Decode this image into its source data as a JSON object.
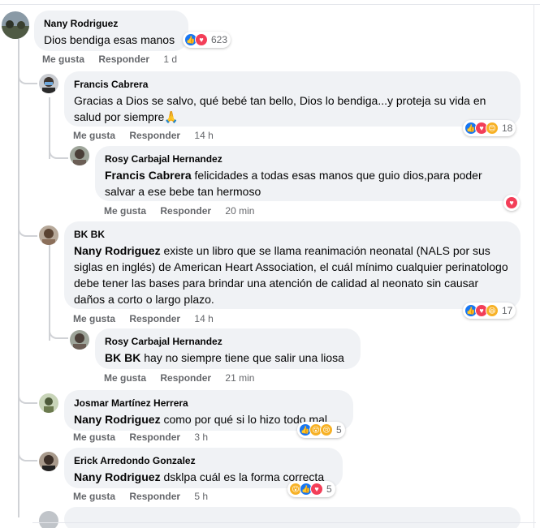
{
  "comments": [
    {
      "author": "Nany Rodriguez",
      "text": "Dios bendiga esas manos",
      "reactions": {
        "icons": [
          "like",
          "love"
        ],
        "count": "623"
      },
      "actions": {
        "like": "Me gusta",
        "reply": "Responder",
        "time": "1 d"
      }
    },
    {
      "author": "Francis Cabrera",
      "text": "Gracias a Dios se salvo, qué bebé tan bello, Dios lo bendiga...y proteja su vida en salud por siempre🙏",
      "reactions": {
        "icons": [
          "like",
          "love",
          "care"
        ],
        "count": "18"
      },
      "actions": {
        "like": "Me gusta",
        "reply": "Responder",
        "time": "14 h"
      }
    },
    {
      "author": "Rosy Carbajal Hernandez",
      "mention": "Francis Cabrera",
      "text": " felicidades a todas esas manos que guio dios,para poder salvar a ese bebe tan hermoso",
      "reactions": {
        "icons": [
          "love"
        ],
        "count": ""
      },
      "actions": {
        "like": "Me gusta",
        "reply": "Responder",
        "time": "20 min"
      }
    },
    {
      "author": "BK BK",
      "mention": "Nany Rodriguez",
      "text": " existe un libro que se llama reanimación neonatal (NALS por sus siglas en inglés) de American Heart Association, el cuál mínimo cualquier perinatologo debe tener las bases para brindar una atención de calidad al neonato sin causar daños a corto o largo plazo.",
      "reactions": {
        "icons": [
          "like",
          "love",
          "haha"
        ],
        "count": "17"
      },
      "actions": {
        "like": "Me gusta",
        "reply": "Responder",
        "time": "14 h"
      }
    },
    {
      "author": "Rosy Carbajal Hernandez",
      "mention": "BK BK",
      "text": " hay no siempre tiene que salir una liosa",
      "actions": {
        "like": "Me gusta",
        "reply": "Responder",
        "time": "21 min"
      }
    },
    {
      "author": "Josmar Martínez Herrera",
      "mention": "Nany Rodriguez",
      "text": " como por qué si lo hizo todo mal",
      "reactions": {
        "icons": [
          "like",
          "wow",
          "sad"
        ],
        "count": "5"
      },
      "actions": {
        "like": "Me gusta",
        "reply": "Responder",
        "time": "3 h"
      }
    },
    {
      "author": "Erick Arredondo Gonzalez",
      "mention": "Nany Rodriguez",
      "text": " dsklpa cuál es la forma correcta",
      "reactions": {
        "icons": [
          "wow",
          "like",
          "love"
        ],
        "count": "5"
      },
      "actions": {
        "like": "Me gusta",
        "reply": "Responder",
        "time": "5 h"
      }
    }
  ],
  "colors": {
    "bubble": "#f0f2f5",
    "like": "#1877f2",
    "love": "#f33e58",
    "secondary_text": "#65676b"
  }
}
